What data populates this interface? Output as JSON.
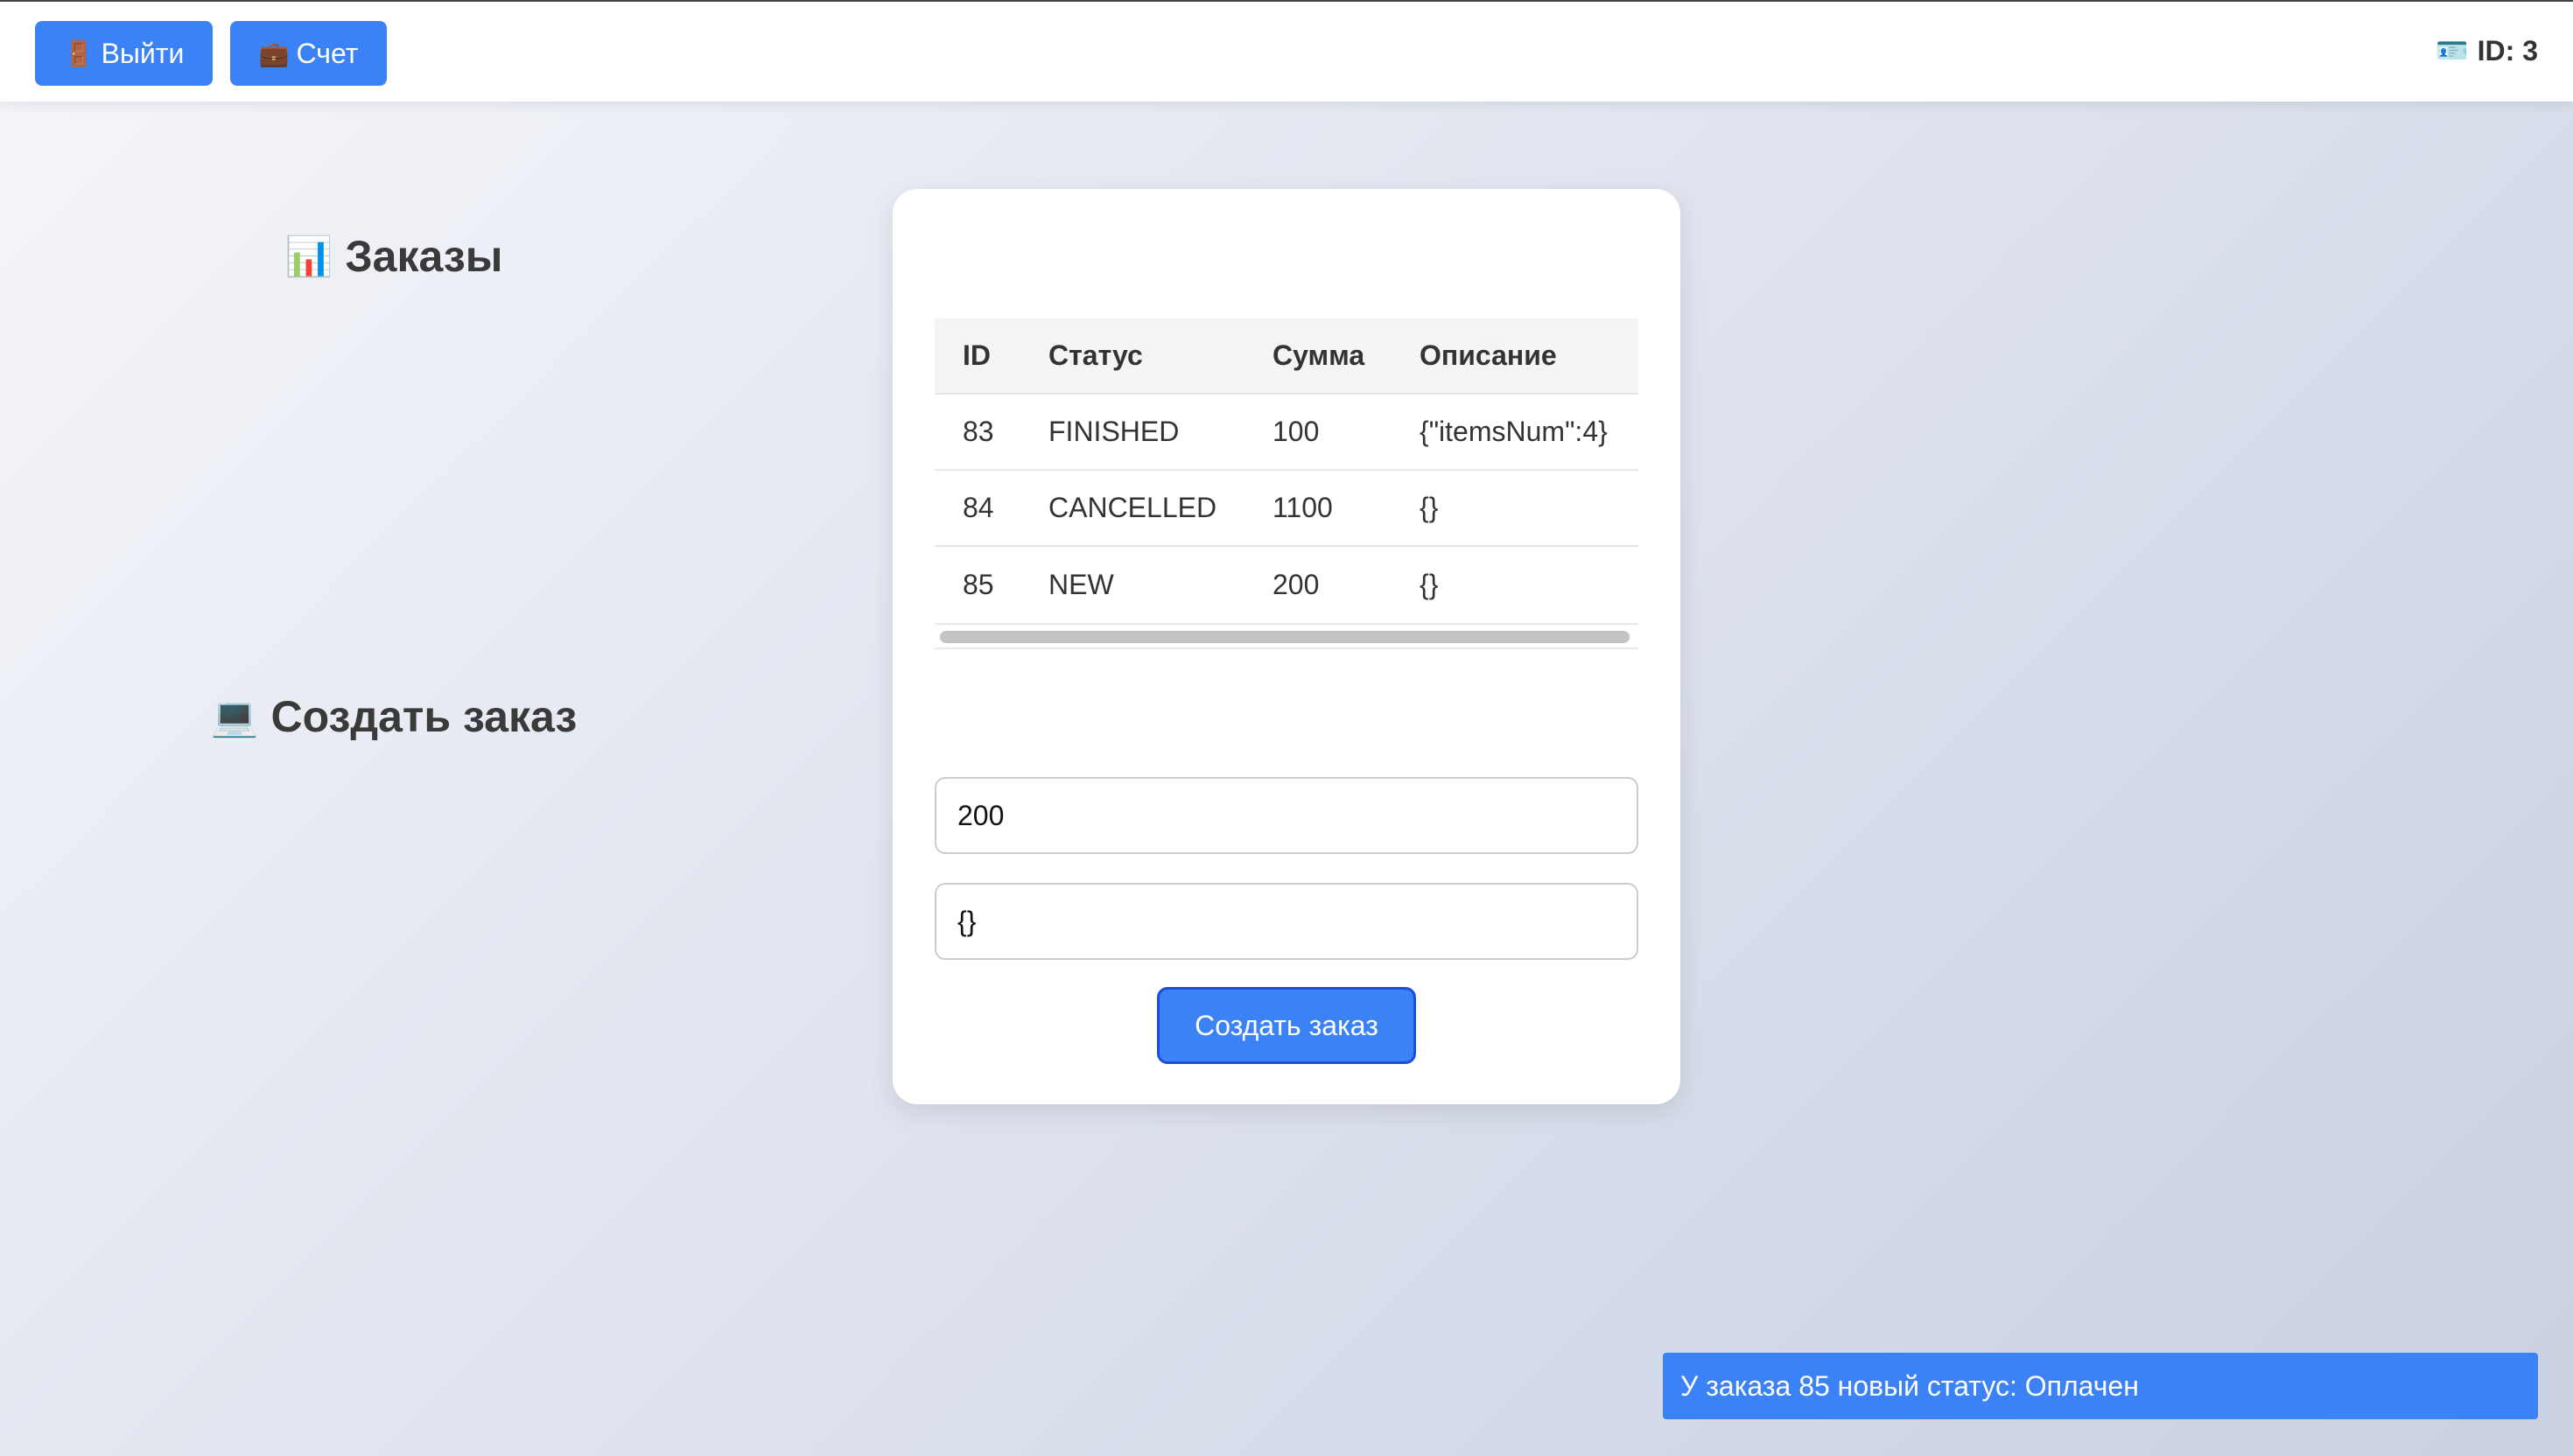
{
  "header": {
    "logout_icon": "🚪",
    "logout_label": "Выйти",
    "account_icon": "💼",
    "account_label": "Счет",
    "user_icon": "🪪",
    "user_id_text": "ID: 3"
  },
  "orders": {
    "title_icon": "📊",
    "title": "Заказы",
    "columns": [
      "ID",
      "Статус",
      "Сумма",
      "Описание"
    ],
    "rows": [
      {
        "id": "83",
        "status": "FINISHED",
        "amount": "100",
        "description": "{\"itemsNum\":4}"
      },
      {
        "id": "84",
        "status": "CANCELLED",
        "amount": "1100",
        "description": "{}"
      },
      {
        "id": "85",
        "status": "NEW",
        "amount": "200",
        "description": "{}"
      }
    ]
  },
  "create": {
    "title_icon": "💻",
    "title": "Создать заказ",
    "amount_value": "200",
    "description_value": "{}",
    "submit_label": "Создать заказ"
  },
  "toast": {
    "message": "У заказа 85 новый статус: Оплачен"
  },
  "colors": {
    "accent": "#3b82f6",
    "card": "#ffffff",
    "table_header": "#f3f4f6"
  }
}
